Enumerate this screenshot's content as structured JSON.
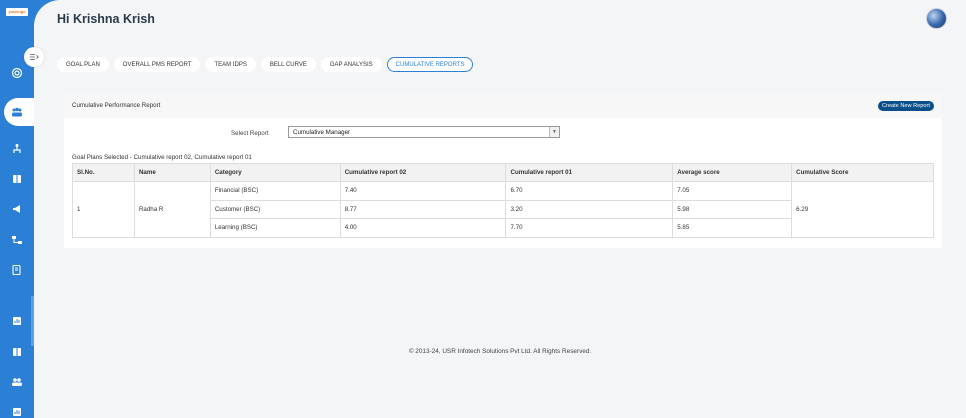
{
  "brand": {
    "logo_text": "yourlogo"
  },
  "header": {
    "greeting": "Hi Krishna Krish"
  },
  "tabs": [
    {
      "label": "GOAL PLAN",
      "active": false
    },
    {
      "label": "OVERALL PMS REPORT",
      "active": false
    },
    {
      "label": "TEAM IDPS",
      "active": false
    },
    {
      "label": "BELL CURVE",
      "active": false
    },
    {
      "label": "GAP ANALYSIS",
      "active": false
    },
    {
      "label": "CUMULATIVE REPORTS",
      "active": true
    }
  ],
  "report": {
    "title": "Cumulative Performance Report",
    "create_button": "Create New Report",
    "select_label": "Select Report",
    "select_value": "Cumulative Manager",
    "selected_plans": "Goal Plans Selected - Cumulative report 02, Cumulative report 01",
    "columns": [
      "Sl.No.",
      "Name",
      "Category",
      "Cumulative report 02",
      "Cumulative report 01",
      "Average score",
      "Cumulative Score"
    ],
    "row": {
      "sl_no": "1",
      "name": "Radha R",
      "cumulative_score": "6.29",
      "categories": [
        {
          "category": "Financial (BSC)",
          "report_02": "7.40",
          "report_01": "6.70",
          "average": "7.05"
        },
        {
          "category": "Customer (BSC)",
          "report_02": "8.77",
          "report_01": "3.20",
          "average": "5.98"
        },
        {
          "category": "Learning (BSC)",
          "report_02": "4.00",
          "report_01": "7.70",
          "average": "5.85"
        }
      ]
    }
  },
  "footer": {
    "copyright": "© 2013-24, USR Infotech Solutions Pvt Ltd. All Rights Reserved."
  },
  "colors": {
    "sidebar": "#2b7fd4",
    "accent": "#2b7fd4",
    "button": "#0b4f8a"
  }
}
